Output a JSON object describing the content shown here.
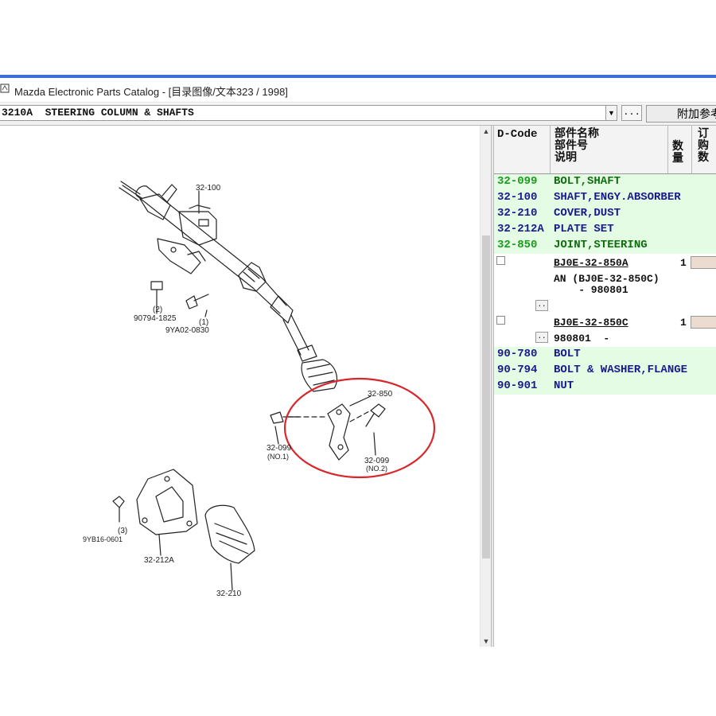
{
  "window": {
    "title": "Mazda Electronic Parts Catalog - [目录图像/文本323 / 1998]"
  },
  "toolbar": {
    "group_selector_value": "3210A  STEERING COLUMN & SHAFTS",
    "dropdown_arrow": "▼",
    "browse_button": "...",
    "additional_button": "附加参考"
  },
  "diagram": {
    "callouts": [
      "32-100",
      "(2)",
      "90794-1825",
      "(1)",
      "9YA02-0830",
      "32-850",
      "32-099",
      "(NO.1)",
      "32-099",
      "(NO.2)",
      "(3)",
      "9YB16-0601",
      "32-212A",
      "32-210"
    ],
    "highlight_color": "#d8262b"
  },
  "parts_list": {
    "headers": {
      "dcode": "D-Code",
      "name": "部件名称",
      "partno": "部件号",
      "desc": "说明",
      "qty": "数量",
      "order": "订购数"
    },
    "rows": [
      {
        "code": "32-099",
        "name": "BOLT,SHAFT"
      },
      {
        "code": "32-100",
        "name": "SHAFT,ENGY.ABSORBER"
      },
      {
        "code": "32-210",
        "name": "COVER,DUST"
      },
      {
        "code": "32-212A",
        "name": "PLATE SET"
      },
      {
        "code": "32-850",
        "name": "JOINT,STEERING"
      }
    ],
    "subs": [
      {
        "part_no": "BJ0E-32-850A",
        "qty": "1",
        "note1": "AN (BJ0E-32-850C)",
        "note2": "    - 980801",
        "more": ".."
      },
      {
        "part_no": "BJ0E-32-850C",
        "qty": "1",
        "note1": "980801  -",
        "more": ".."
      }
    ],
    "rows2": [
      {
        "code": "90-780",
        "name": "BOLT"
      },
      {
        "code": "90-794",
        "name": "BOLT & WASHER,FLANGE"
      },
      {
        "code": "90-901",
        "name": "NUT"
      }
    ]
  }
}
